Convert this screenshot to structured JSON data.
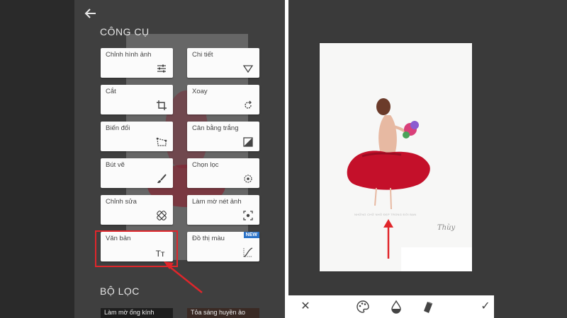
{
  "left_panel": {
    "tools_heading": "CÔNG CỤ",
    "filters_heading": "BỘ LỌC",
    "tools": [
      {
        "label": "Chỉnh hình ảnh",
        "icon": "sliders-icon"
      },
      {
        "label": "Chi tiết",
        "icon": "triangle-down-icon"
      },
      {
        "label": "Cắt",
        "icon": "crop-icon"
      },
      {
        "label": "Xoay",
        "icon": "rotate-icon"
      },
      {
        "label": "Biến đổi",
        "icon": "perspective-icon"
      },
      {
        "label": "Cân bằng trắng",
        "icon": "white-balance-icon"
      },
      {
        "label": "Bút vẽ",
        "icon": "brush-icon"
      },
      {
        "label": "Chọn lọc",
        "icon": "selective-icon"
      },
      {
        "label": "Chỉnh sửa",
        "icon": "healing-icon"
      },
      {
        "label": "Làm mờ nét ảnh",
        "icon": "vignette-icon"
      },
      {
        "label": "Văn bản",
        "icon": "text-icon"
      },
      {
        "label": "Đồ thị màu",
        "icon": "curves-icon",
        "badge": "NEW"
      }
    ],
    "filters": [
      {
        "label": "Làm mờ ống kính"
      },
      {
        "label": "Tỏa sáng huyền ảo"
      }
    ],
    "text_tool_glyph": "Tт",
    "highlight_color": "#e0262b"
  },
  "right_panel": {
    "caption": "NHỮNG CHỮ NHỎ ĐẸP TRONG ĐỜI BẠN",
    "signature": "Thùy",
    "toolbar": {
      "close": "✕",
      "confirm": "✓"
    },
    "accent": "#e0262b"
  }
}
